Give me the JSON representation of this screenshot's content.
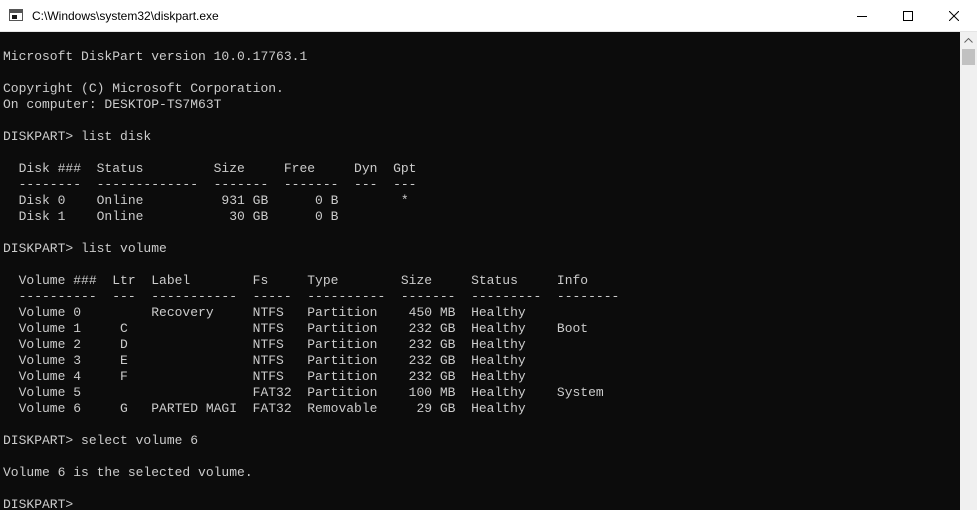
{
  "window": {
    "title": "C:\\Windows\\system32\\diskpart.exe"
  },
  "icons": {
    "app": "console-app-icon",
    "minimize": "minimize-icon",
    "maximize": "maximize-icon",
    "close": "close-icon",
    "scroll_up": "chevron-up-icon"
  },
  "colors": {
    "console_background": "#0c0c0c",
    "console_text": "#cccccc",
    "titlebar_background": "#ffffff"
  },
  "console": {
    "lines": [
      "Microsoft DiskPart version 10.0.17763.1",
      "",
      "Copyright (C) Microsoft Corporation.",
      "On computer: DESKTOP-TS7M63T",
      "",
      "DISKPART> list disk",
      "",
      "  Disk ###  Status         Size     Free     Dyn  Gpt",
      "  --------  -------------  -------  -------  ---  ---",
      "  Disk 0    Online          931 GB      0 B        *",
      "  Disk 1    Online           30 GB      0 B",
      "",
      "DISKPART> list volume",
      "",
      "  Volume ###  Ltr  Label        Fs     Type        Size     Status     Info",
      "  ----------  ---  -----------  -----  ----------  -------  ---------  --------",
      "  Volume 0         Recovery     NTFS   Partition    450 MB  Healthy",
      "  Volume 1     C                NTFS   Partition    232 GB  Healthy    Boot",
      "  Volume 2     D                NTFS   Partition    232 GB  Healthy",
      "  Volume 3     E                NTFS   Partition    232 GB  Healthy",
      "  Volume 4     F                NTFS   Partition    232 GB  Healthy",
      "  Volume 5                      FAT32  Partition    100 MB  Healthy    System",
      "  Volume 6     G   PARTED MAGI  FAT32  Removable     29 GB  Healthy",
      "",
      "DISKPART> select volume 6",
      "",
      "Volume 6 is the selected volume.",
      "",
      "DISKPART> "
    ]
  }
}
